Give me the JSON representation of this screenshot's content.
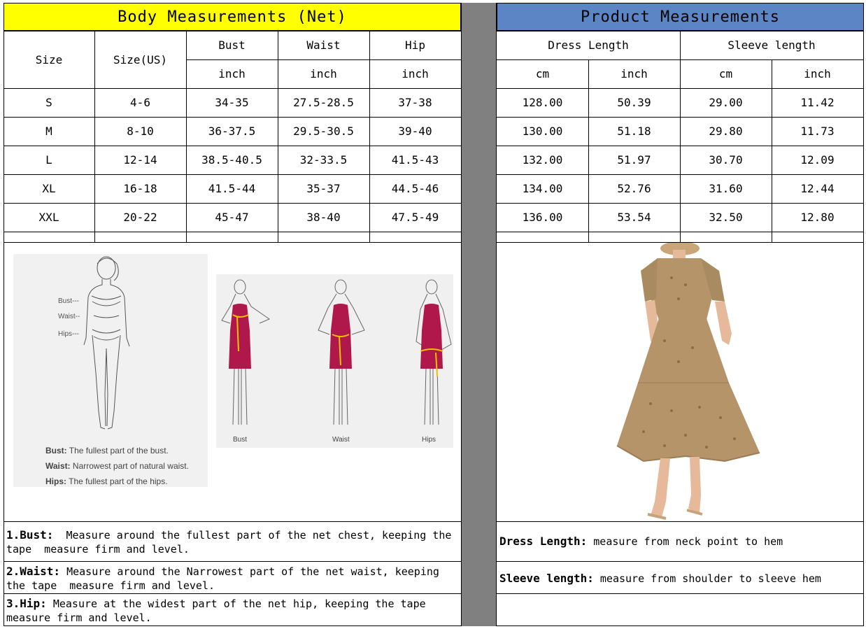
{
  "body": {
    "title": "Body Measurements (Net)",
    "headers": {
      "size": "Size",
      "size_us": "Size(US)",
      "bust": "Bust",
      "waist": "Waist",
      "hip": "Hip",
      "unit": "inch"
    },
    "rows": [
      [
        "S",
        "4-6",
        "34-35",
        "27.5-28.5",
        "37-38"
      ],
      [
        "M",
        "8-10",
        "36-37.5",
        "29.5-30.5",
        "39-40"
      ],
      [
        "L",
        "12-14",
        "38.5-40.5",
        "32-33.5",
        "41.5-43"
      ],
      [
        "XL",
        "16-18",
        "41.5-44",
        "35-37",
        "44.5-46"
      ],
      [
        "XXL",
        "20-22",
        "45-47",
        "38-40",
        "47.5-49"
      ]
    ]
  },
  "product": {
    "title": "Product Measurements",
    "headers": {
      "dress_length": "Dress Length",
      "sleeve_length": "Sleeve length",
      "cm": "cm",
      "inch": "inch"
    },
    "rows": [
      [
        "128.00",
        "50.39",
        "29.00",
        "11.42"
      ],
      [
        "130.00",
        "51.18",
        "29.80",
        "11.73"
      ],
      [
        "132.00",
        "51.97",
        "30.70",
        "12.09"
      ],
      [
        "134.00",
        "52.76",
        "31.60",
        "12.44"
      ],
      [
        "136.00",
        "53.54",
        "32.50",
        "12.80"
      ]
    ]
  },
  "illustration": {
    "figure_labels": {
      "bust": "Bust---",
      "waist": "Waist--",
      "hips": "Hips---"
    },
    "legend": [
      {
        "term": "Bust:",
        "text": "The fullest part of the bust."
      },
      {
        "term": "Waist:",
        "text": "Narrowest part of natural waist."
      },
      {
        "term": "Hips:",
        "text": "The fullest part of the hips."
      }
    ],
    "dress_captions": [
      "Bust",
      "Waist",
      "Hips"
    ]
  },
  "notes_left": [
    {
      "term": "1.Bust:",
      "line1": "  Measure around the fullest part of the net chest, keeping the",
      "line2": "tape  measure firm and level."
    },
    {
      "term": "2.Waist:",
      "line1": " Measure around the Narrowest part of the net waist, keeping",
      "line2": "the tape  measure firm and level."
    },
    {
      "term": "3.Hip:",
      "line1": " Measure at the widest part of the net hip, keeping the tape",
      "line2": "measure firm and level."
    }
  ],
  "notes_right": [
    {
      "term": "Dress Length:",
      "text": " measure from neck point to hem"
    },
    {
      "term": "Sleeve length:",
      "text": " measure from shoulder to sleeve hem"
    }
  ],
  "colors": {
    "left_header": "#ffff00",
    "right_header": "#5b85c4",
    "divider": "#808080",
    "dress": "#b5946a",
    "mannequin_dress": "#b0174a",
    "tape": "#f2c200"
  }
}
